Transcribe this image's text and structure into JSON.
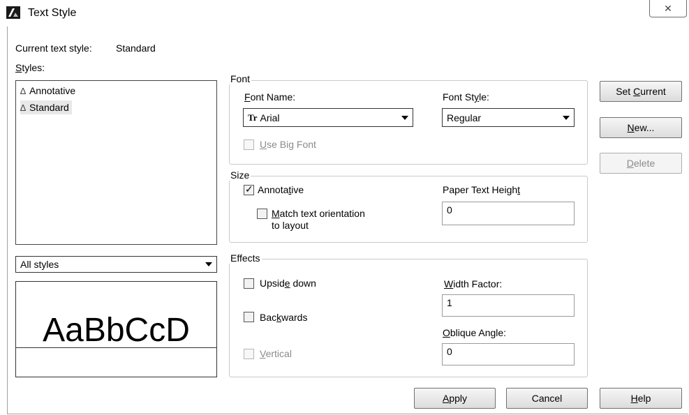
{
  "window": {
    "title": "Text Style",
    "close_glyph": "✕"
  },
  "current_style": {
    "label": "Current text style:",
    "value": "Standard"
  },
  "styles": {
    "label_u": "S",
    "label_rest": "tyles:",
    "items": [
      {
        "name": "Annotative",
        "glyph": "∆",
        "selected": false
      },
      {
        "name": "Standard",
        "glyph": "∆",
        "selected": true
      }
    ],
    "filter_value": "All styles"
  },
  "preview": {
    "text": "AaBbCcD"
  },
  "font_group": {
    "legend": "Font",
    "font_name_label_u": "F",
    "font_name_label_rest": "ont Name:",
    "font_name_value": "Arial",
    "font_name_icon": "Tr",
    "font_style_label_pre": "Font St",
    "font_style_label_u": "y",
    "font_style_label_post": "le:",
    "font_style_value": "Regular",
    "use_big_font_u": "U",
    "use_big_font_rest": "se Big Font"
  },
  "size_group": {
    "legend": "Size",
    "annotative_pre": "Annota",
    "annotative_u": "t",
    "annotative_post": "ive",
    "match_u": "M",
    "match_rest": "atch text orientation",
    "match_line2": "to layout",
    "paper_height_pre": "Paper Text Heigh",
    "paper_height_u": "t",
    "paper_height_value": "0"
  },
  "effects_group": {
    "legend": "Effects",
    "upside_pre": "Upsid",
    "upside_u": "e",
    "upside_post": " down",
    "backwards_pre": "Bac",
    "backwards_u": "k",
    "backwards_post": "wards",
    "vertical_u": "V",
    "vertical_rest": "ertical",
    "width_u": "W",
    "width_rest": "idth Factor:",
    "width_value": "1",
    "oblique_u": "O",
    "oblique_rest": "blique Angle:",
    "oblique_value": "0"
  },
  "side_buttons": {
    "set_current_pre": "Set ",
    "set_current_u": "C",
    "set_current_post": "urrent",
    "new_u": "N",
    "new_rest": "ew...",
    "delete_u": "D",
    "delete_rest": "elete"
  },
  "bottom_buttons": {
    "apply_u": "A",
    "apply_rest": "pply",
    "cancel": "Cancel",
    "help_u": "H",
    "help_rest": "elp"
  }
}
